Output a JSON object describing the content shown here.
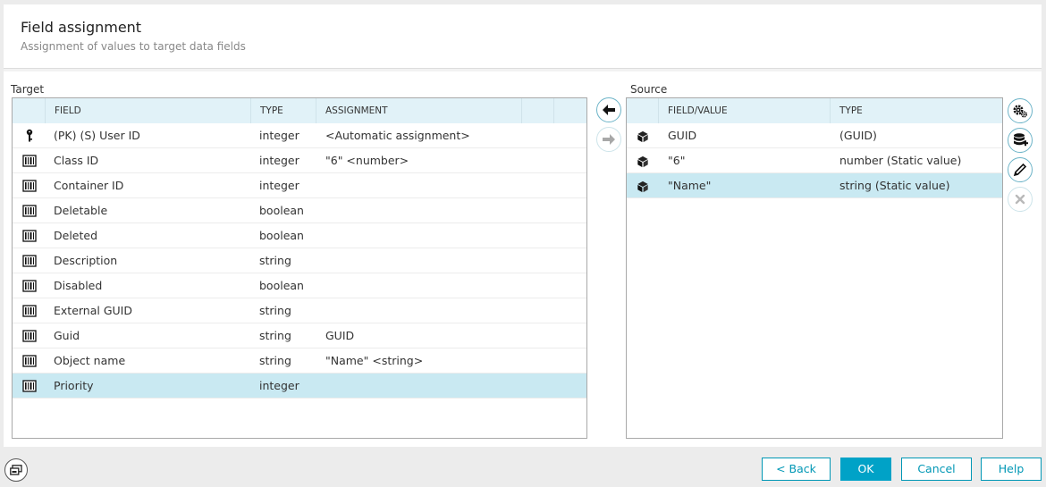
{
  "header": {
    "title": "Field assignment",
    "subtitle": "Assignment of values to target data fields"
  },
  "target": {
    "label": "Target",
    "columns": [
      "FIELD",
      "TYPE",
      "ASSIGNMENT"
    ],
    "rows": [
      {
        "icon": "key-icon",
        "field": "(PK) (S) User ID",
        "type": "integer",
        "assignment": "<Automatic assignment>"
      },
      {
        "icon": "field-icon",
        "field": "Class ID",
        "type": "integer",
        "assignment": "\"6\" <number>"
      },
      {
        "icon": "field-icon",
        "field": "Container ID",
        "type": "integer",
        "assignment": ""
      },
      {
        "icon": "field-icon",
        "field": "Deletable",
        "type": "boolean",
        "assignment": ""
      },
      {
        "icon": "field-icon",
        "field": "Deleted",
        "type": "boolean",
        "assignment": ""
      },
      {
        "icon": "field-icon",
        "field": "Description",
        "type": "string",
        "assignment": ""
      },
      {
        "icon": "field-icon",
        "field": "Disabled",
        "type": "boolean",
        "assignment": ""
      },
      {
        "icon": "field-icon",
        "field": "External GUID",
        "type": "string",
        "assignment": ""
      },
      {
        "icon": "field-icon",
        "field": "Guid",
        "type": "string",
        "assignment": "GUID"
      },
      {
        "icon": "field-icon",
        "field": "Object name",
        "type": "string",
        "assignment": "\"Name\" <string>"
      },
      {
        "icon": "field-icon",
        "field": "Priority",
        "type": "integer",
        "assignment": "",
        "selected": true
      }
    ]
  },
  "source": {
    "label": "Source",
    "columns": [
      "FIELD/VALUE",
      "TYPE"
    ],
    "rows": [
      {
        "icon": "cube-icon",
        "value": "GUID",
        "type": "(GUID)"
      },
      {
        "icon": "cube-icon",
        "value": "\"6\"",
        "type": "number (Static value)"
      },
      {
        "icon": "cube-icon",
        "value": "\"Name\"",
        "type": "string (Static value)",
        "selected": true
      }
    ]
  },
  "footer": {
    "back_label": "< Back",
    "ok_label": "OK",
    "cancel_label": "Cancel",
    "help_label": "Help"
  },
  "colors": {
    "accent": "#00a2c7",
    "header_row": "#e1f2f8",
    "selected_row": "#c9e9f2"
  }
}
